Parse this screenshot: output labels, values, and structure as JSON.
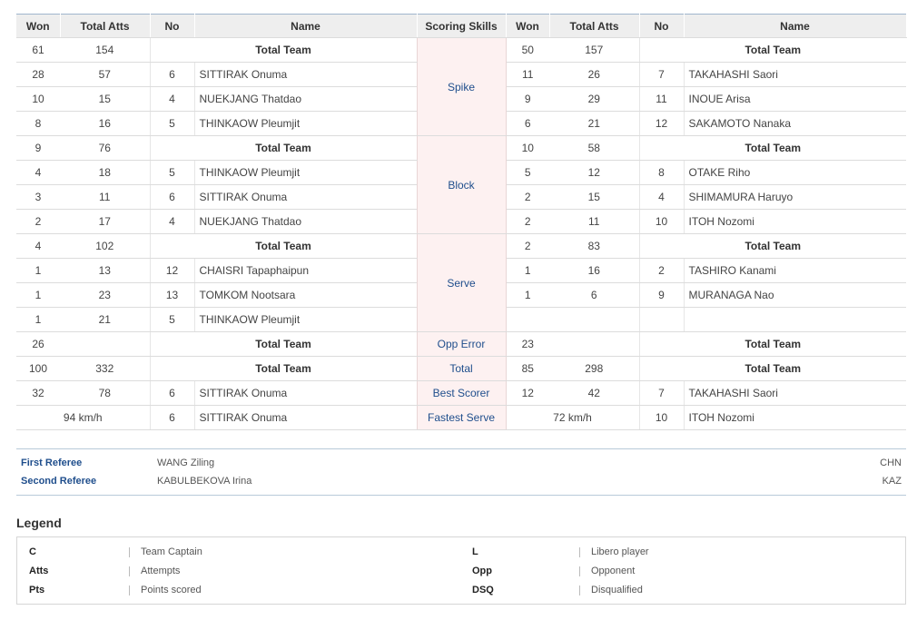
{
  "headers": {
    "won_left": "Won",
    "atts_left": "Total Atts",
    "no_left": "No",
    "name_left": "Name",
    "skills": "Scoring Skills",
    "won_right": "Won",
    "atts_right": "Total Atts",
    "no_right": "No",
    "name_right": "Name"
  },
  "total_team_label": "Total Team",
  "sections": [
    {
      "skill": "Spike",
      "total": {
        "l_won": "61",
        "l_atts": "154",
        "r_won": "50",
        "r_atts": "157"
      },
      "rows": [
        {
          "l_won": "28",
          "l_atts": "57",
          "l_no": "6",
          "l_name": "SITTIRAK Onuma",
          "r_won": "11",
          "r_atts": "26",
          "r_no": "7",
          "r_name": "TAKAHASHI Saori"
        },
        {
          "l_won": "10",
          "l_atts": "15",
          "l_no": "4",
          "l_name": "NUEKJANG Thatdao",
          "r_won": "9",
          "r_atts": "29",
          "r_no": "11",
          "r_name": "INOUE Arisa"
        },
        {
          "l_won": "8",
          "l_atts": "16",
          "l_no": "5",
          "l_name": "THINKAOW Pleumjit",
          "r_won": "6",
          "r_atts": "21",
          "r_no": "12",
          "r_name": "SAKAMOTO Nanaka"
        }
      ]
    },
    {
      "skill": "Block",
      "total": {
        "l_won": "9",
        "l_atts": "76",
        "r_won": "10",
        "r_atts": "58"
      },
      "rows": [
        {
          "l_won": "4",
          "l_atts": "18",
          "l_no": "5",
          "l_name": "THINKAOW Pleumjit",
          "r_won": "5",
          "r_atts": "12",
          "r_no": "8",
          "r_name": "OTAKE Riho"
        },
        {
          "l_won": "3",
          "l_atts": "11",
          "l_no": "6",
          "l_name": "SITTIRAK Onuma",
          "r_won": "2",
          "r_atts": "15",
          "r_no": "4",
          "r_name": "SHIMAMURA Haruyo"
        },
        {
          "l_won": "2",
          "l_atts": "17",
          "l_no": "4",
          "l_name": "NUEKJANG Thatdao",
          "r_won": "2",
          "r_atts": "11",
          "r_no": "10",
          "r_name": "ITOH Nozomi"
        }
      ]
    },
    {
      "skill": "Serve",
      "total": {
        "l_won": "4",
        "l_atts": "102",
        "r_won": "2",
        "r_atts": "83"
      },
      "rows": [
        {
          "l_won": "1",
          "l_atts": "13",
          "l_no": "12",
          "l_name": "CHAISRI Tapaphaipun",
          "r_won": "1",
          "r_atts": "16",
          "r_no": "2",
          "r_name": "TASHIRO Kanami"
        },
        {
          "l_won": "1",
          "l_atts": "23",
          "l_no": "13",
          "l_name": "TOMKOM Nootsara",
          "r_won": "1",
          "r_atts": "6",
          "r_no": "9",
          "r_name": "MURANAGA Nao"
        },
        {
          "l_won": "1",
          "l_atts": "21",
          "l_no": "5",
          "l_name": "THINKAOW Pleumjit",
          "r_won": "",
          "r_atts": "",
          "r_no": "",
          "r_name": ""
        }
      ]
    }
  ],
  "opp_error": {
    "skill": "Opp Error",
    "l_won": "26",
    "r_won": "23"
  },
  "total": {
    "skill": "Total",
    "l_won": "100",
    "l_atts": "332",
    "r_won": "85",
    "r_atts": "298"
  },
  "best_scorer": {
    "skill": "Best Scorer",
    "l_won": "32",
    "l_atts": "78",
    "l_no": "6",
    "l_name": "SITTIRAK Onuma",
    "r_won": "12",
    "r_atts": "42",
    "r_no": "7",
    "r_name": "TAKAHASHI Saori"
  },
  "fastest_serve": {
    "skill": "Fastest Serve",
    "l_speed": "94 km/h",
    "l_no": "6",
    "l_name": "SITTIRAK Onuma",
    "r_speed": "72 km/h",
    "r_no": "10",
    "r_name": "ITOH Nozomi"
  },
  "referees": [
    {
      "label": "First Referee",
      "name": "WANG Ziling",
      "country": "CHN"
    },
    {
      "label": "Second Referee",
      "name": "KABULBEKOVA Irina",
      "country": "KAZ"
    }
  ],
  "legend_title": "Legend",
  "legend": [
    {
      "key": "C",
      "value": "Team Captain"
    },
    {
      "key": "L",
      "value": "Libero player"
    },
    {
      "key": "Atts",
      "value": "Attempts"
    },
    {
      "key": "Opp",
      "value": "Opponent"
    },
    {
      "key": "Pts",
      "value": "Points scored"
    },
    {
      "key": "DSQ",
      "value": "Disqualified"
    }
  ],
  "colors": {
    "skill_bg": "#fdf1f1",
    "skill_text": "#1f4e8c",
    "header_bg": "#eeeeee"
  }
}
